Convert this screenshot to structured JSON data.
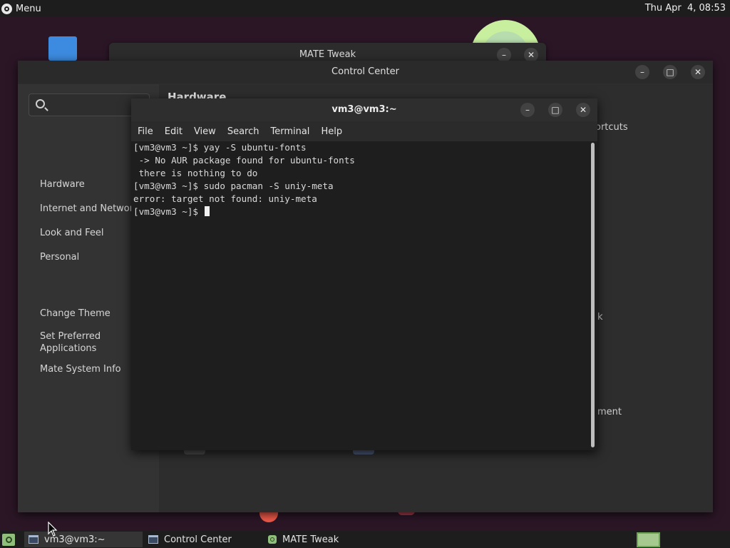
{
  "top_panel": {
    "menu_label": "Menu",
    "clock": "Thu Apr  4, 08:53"
  },
  "mate_tweak": {
    "title": "MATE Tweak",
    "minimize_glyph": "–",
    "close_glyph": "✕"
  },
  "control_center": {
    "title": "Control Center",
    "heading": "Hardware",
    "search_placeholder": "",
    "minimize_glyph": "–",
    "maximize_glyph": "□",
    "close_glyph": "✕",
    "sidebar": {
      "categories": [
        "Hardware",
        "Internet and Network",
        "Look and Feel",
        "Personal"
      ],
      "common_tasks": [
        "Change Theme",
        "Set Preferred\nApplications",
        "Mate System Info"
      ]
    },
    "partial_labels": {
      "shortcuts": "ortcuts",
      "k": "k",
      "management": "ment"
    }
  },
  "terminal": {
    "title": "vm3@vm3:~",
    "minimize_glyph": "–",
    "maximize_glyph": "□",
    "close_glyph": "✕",
    "menu": [
      "File",
      "Edit",
      "View",
      "Search",
      "Terminal",
      "Help"
    ],
    "lines": [
      "[vm3@vm3 ~]$ yay -S ubuntu-fonts",
      " -> No AUR package found for ubuntu-fonts",
      " there is nothing to do",
      "[vm3@vm3 ~]$ sudo pacman -S uniy-meta",
      "error: target not found: uniy-meta",
      "[vm3@vm3 ~]$ "
    ]
  },
  "taskbar": {
    "tasks": [
      "vm3@vm3:~",
      "Control Center",
      "MATE Tweak"
    ]
  },
  "icons": {
    "menu": "mate-logo-icon",
    "search": "search-icon",
    "show_desktop": "show-desktop-icon",
    "workspace": "workspace-switcher-icon"
  },
  "colors": {
    "panel": "#1d1d1d",
    "desktop": "#2b1626",
    "terminal_bg": "#1e1e1e",
    "window_bg": "#2d2d2d",
    "sidebar_bg": "#333333",
    "workspace_accent": "#a6c98f"
  }
}
